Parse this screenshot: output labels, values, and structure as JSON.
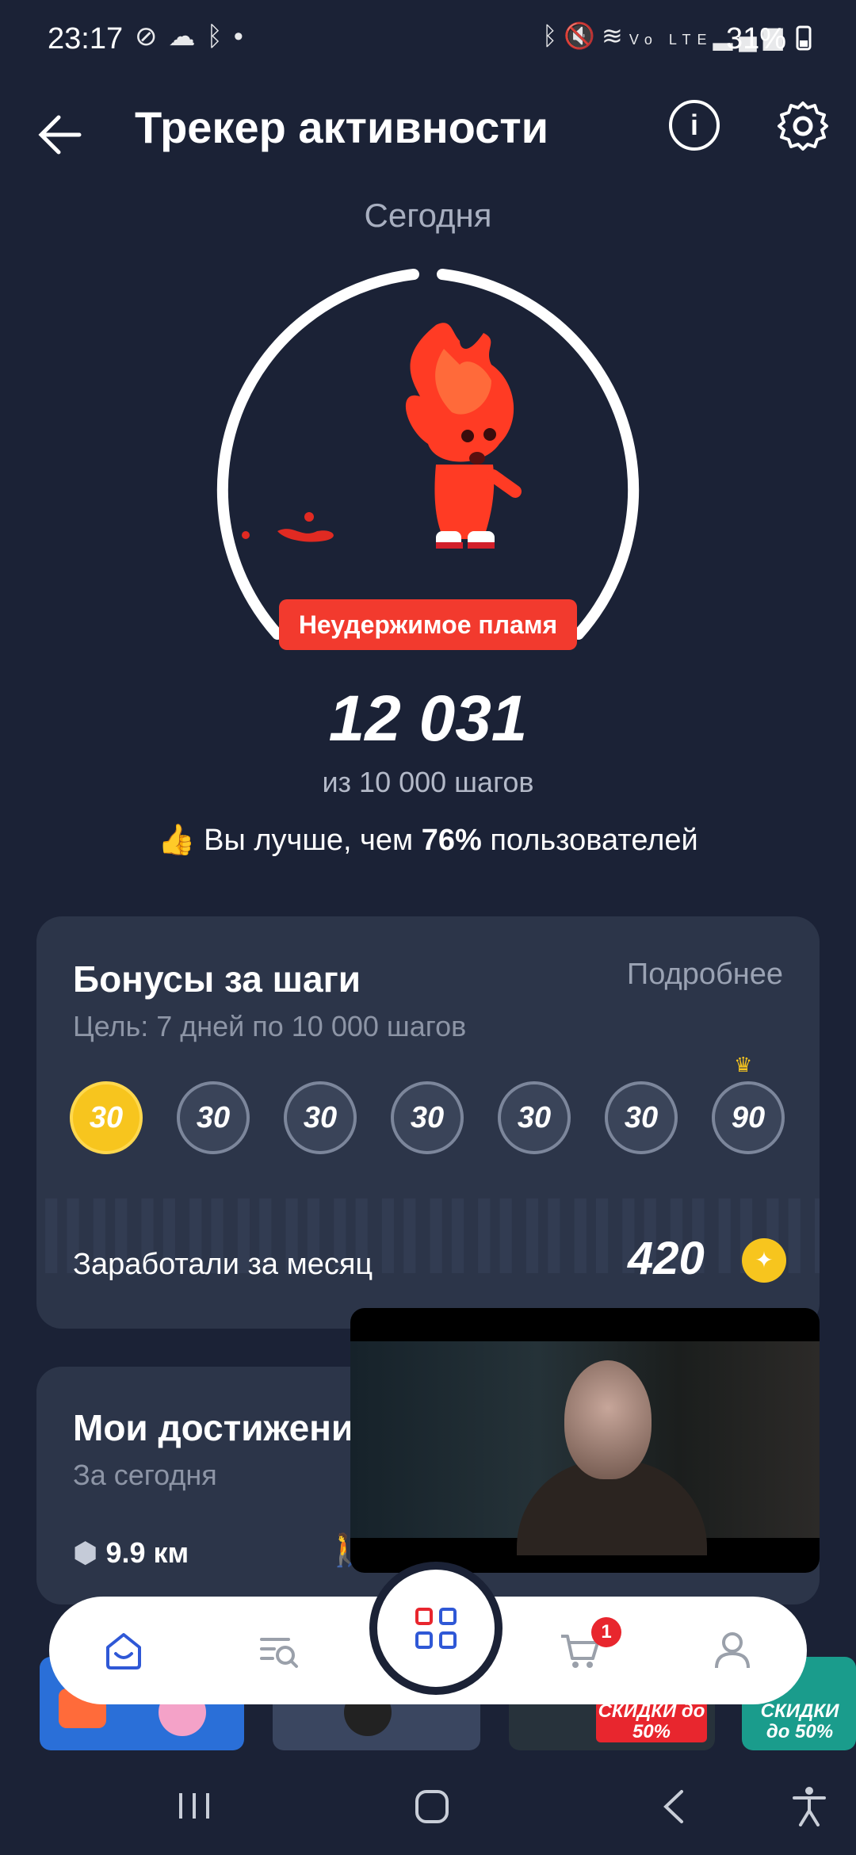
{
  "status_bar": {
    "time": "23:17",
    "left_icons": [
      "do-not-disturb-icon",
      "cloud-icon",
      "bluetooth-icon",
      "dot-icon"
    ],
    "right_icons": [
      "bluetooth-icon",
      "mute-icon",
      "wifi-icon",
      "volte-icon",
      "signal-icon"
    ],
    "battery": "31%"
  },
  "header": {
    "title": "Трекер активности",
    "info_label": "i"
  },
  "tracker": {
    "period": "Сегодня",
    "status_badge": "Неудержимое пламя",
    "steps": "12 031",
    "goal_text": "из 10 000 шагов",
    "comparison_prefix": "Вы лучше, чем",
    "comparison_value": "76%",
    "comparison_suffix": "пользователей",
    "progress_fraction": 1.0
  },
  "bonuses": {
    "title": "Бонусы за шаги",
    "more_link": "Подробнее",
    "goal": "Цель: 7 дней по 10 000 шагов",
    "days": [
      {
        "value": "30",
        "achieved": true
      },
      {
        "value": "30",
        "achieved": false
      },
      {
        "value": "30",
        "achieved": false
      },
      {
        "value": "30",
        "achieved": false
      },
      {
        "value": "30",
        "achieved": false
      },
      {
        "value": "30",
        "achieved": false
      },
      {
        "value": "90",
        "achieved": false,
        "crown": true
      }
    ],
    "earned_label": "Заработали за месяц",
    "earned_value": "420"
  },
  "achievements": {
    "title": "Мои достижени",
    "subtitle": "За сегодня",
    "distance": "9.9 км"
  },
  "bottom_nav": {
    "items": [
      "home-icon",
      "catalog-search-icon",
      "apps-grid-icon",
      "cart-icon",
      "profile-icon"
    ],
    "cart_badge": "1"
  },
  "banners": [
    {
      "text": ""
    },
    {
      "text": ""
    },
    {
      "text": "СКИДКИ до 50%"
    },
    {
      "text": "СКИДКИ до 50%"
    }
  ],
  "colors": {
    "background": "#1b2236",
    "card": "#2c3549",
    "accent_red": "#f23a2e",
    "coin_gold": "#f7c51e",
    "nav_blue": "#2f58d6"
  }
}
